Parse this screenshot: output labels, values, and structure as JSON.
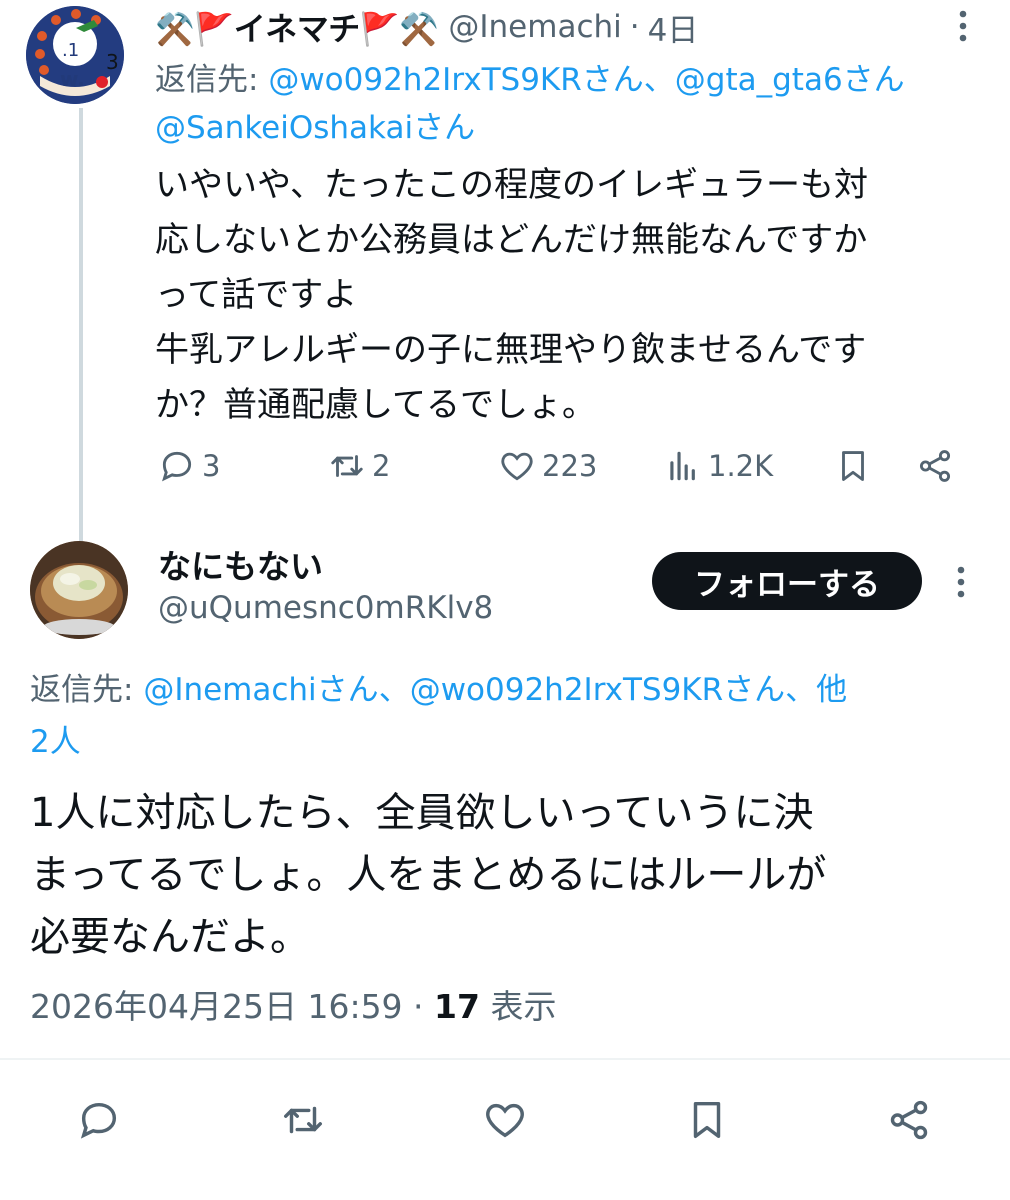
{
  "tweet1": {
    "author_name": "⚒️🚩イネマチ🚩⚒️",
    "handle": "@Inemachi",
    "separator": "·",
    "time": "4日",
    "reply_prefix": "返信先: ",
    "reply_mentions": [
      "@wo092h2IrxTS9KRさん",
      "@gta_gta6さん",
      "@SankeiOshakaiさん"
    ],
    "reply_separator": "、",
    "body": "いやいや、たったこの程度のイレギュラーも対\n応しないとか公務員はどんだけ無能なんですか\nって話ですよ\n牛乳アレルギーの子に無理やり飲ませるんです\nか？普通配慮してるでしょ。",
    "stats": {
      "replies": "3",
      "retweets": "2",
      "likes": "223",
      "views": "1.2K"
    },
    "avatar_badge": "3"
  },
  "tweet2": {
    "author_name": "なにもない",
    "handle": "@uQumesnc0mRKlv8",
    "follow_label": "フォローする",
    "reply_prefix": "返信先: ",
    "reply_mention1": "@Inemachiさん",
    "reply_separator": "、",
    "reply_mention2": "@wo092h2IrxTS9KRさん",
    "reply_others_1": "、他",
    "reply_others_2": "2人",
    "body": "1人に対応したら、全員欲しいっていうに決\nまってるでしょ。人をまとめるにはルールが\n必要なんだよ。",
    "timestamp": "2026年04月25日 16:59",
    "meta_separator": " · ",
    "view_count": "17",
    "view_label": " 表示"
  },
  "icons": [
    "more-icon",
    "reply-icon",
    "retweet-icon",
    "like-icon",
    "views-icon",
    "bookmark-icon",
    "share-icon"
  ],
  "colors": {
    "accent": "#1d9bf0",
    "secondary_text": "#536471",
    "primary_text": "#0f1419",
    "follow_button": "#0f1419"
  }
}
